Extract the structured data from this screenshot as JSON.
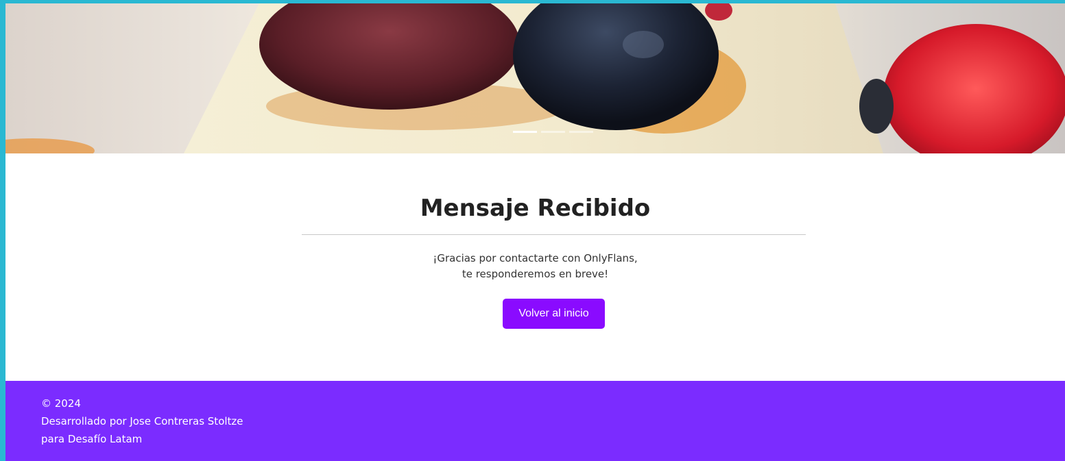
{
  "hero": {
    "image_alt": "Flan con frutos rojos",
    "slides": [
      {
        "active": true
      },
      {
        "active": false
      },
      {
        "active": false
      }
    ]
  },
  "main": {
    "title": "Mensaje Recibido",
    "message_line1": "¡Gracias por contactarte con OnlyFlans,",
    "message_line2": "te responderemos en breve!",
    "button_label": "Volver al inicio"
  },
  "footer": {
    "copyright": "© 2024",
    "credit_line1": "Desarrollado por Jose Contreras Stoltze",
    "credit_line2": "para Desafío Latam"
  },
  "colors": {
    "accent": "#8a0bff",
    "footer_bg": "#7b2cff",
    "frame": "#2ab8d2"
  }
}
